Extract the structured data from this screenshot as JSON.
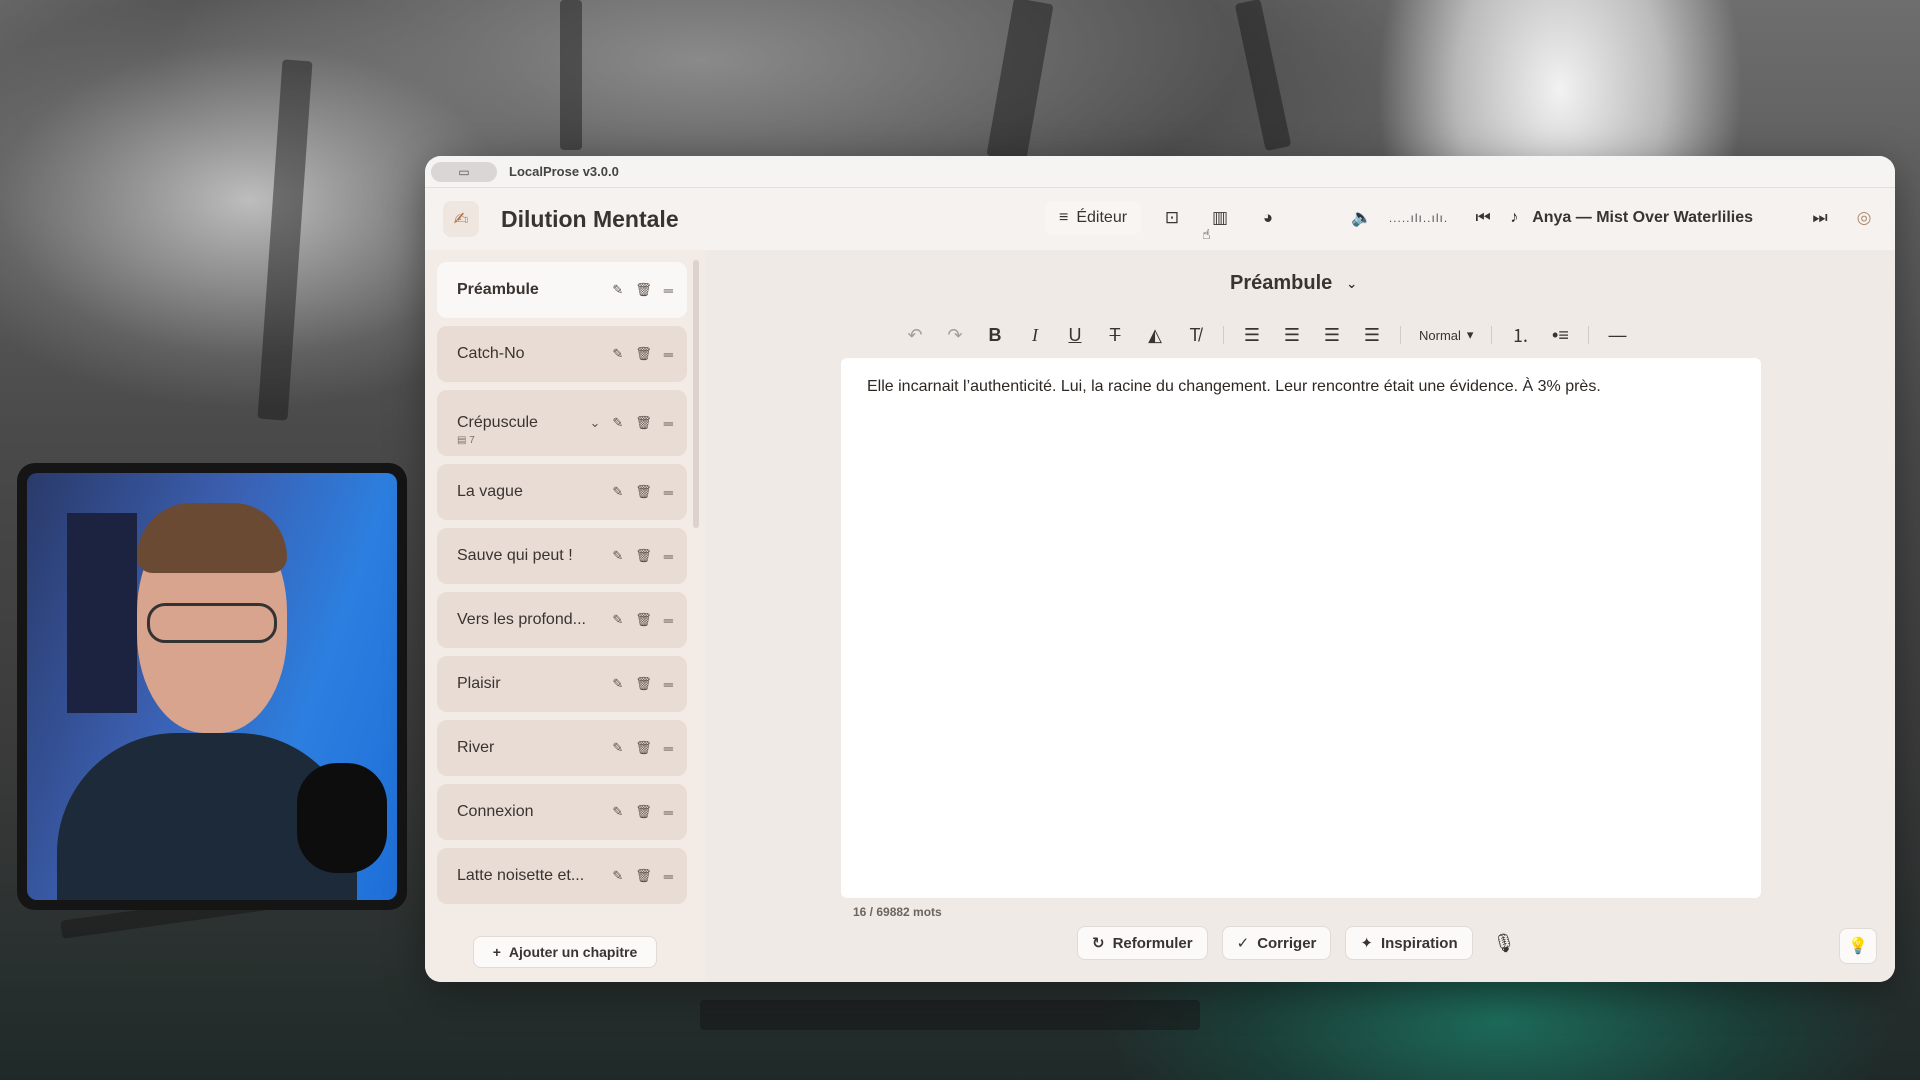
{
  "window": {
    "title": "LocalProse v3.0.0"
  },
  "header": {
    "doc_title": "Dilution Mentale",
    "mode_label": "Éditeur",
    "track": "Anya — Mist Over Waterlilies"
  },
  "sidebar": {
    "chapters": [
      {
        "label": "Préambule",
        "active": true
      },
      {
        "label": "Catch-No"
      },
      {
        "label": "Crépuscule",
        "sub": "7"
      },
      {
        "label": "La vague"
      },
      {
        "label": "Sauve qui peut !"
      },
      {
        "label": "Vers les profond..."
      },
      {
        "label": "Plaisir"
      },
      {
        "label": "River"
      },
      {
        "label": "Connexion"
      },
      {
        "label": "Latte noisette et..."
      }
    ],
    "add_label": "Ajouter un chapitre"
  },
  "editor": {
    "chapter_title": "Préambule",
    "format_select": "Normal",
    "text": "Elle incarnait l’authenticité. Lui, la racine du changement. Leur rencontre était une évidence. À 3% près.",
    "word_count": "16 / 69882 mots"
  },
  "actions": {
    "rephrase": "Reformuler",
    "correct": "Corriger",
    "inspiration": "Inspiration"
  }
}
